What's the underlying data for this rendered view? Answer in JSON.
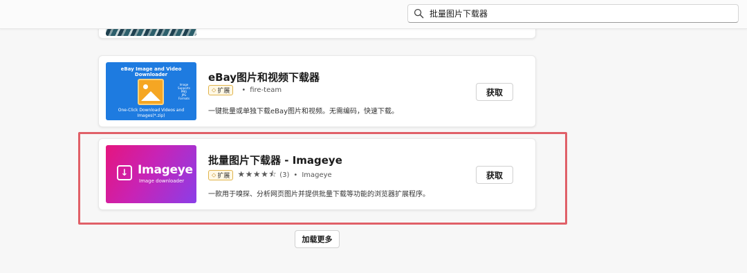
{
  "search": {
    "value": "批量图片下载器",
    "icon": "search-icon"
  },
  "results": [
    {
      "id": "ebay",
      "title": "eBay图片和视频下载器",
      "badge": "扩展",
      "publisher": "fire-team",
      "description": "一键批量或单独下载eBay图片和视频。无需编码，快速下载。",
      "get_label": "获取",
      "thumb": {
        "headline": "eBay Image and Video Downloader",
        "side_lines": [
          "Image",
          "Supports",
          "PNG",
          "JPG",
          "Formats"
        ],
        "bottom": "One-Click Download Videos and Images(*.zip)"
      },
      "accent": "#1e7be0"
    },
    {
      "id": "imageeye",
      "title": "批量图片下载器",
      "title_separator": " - ",
      "title_dev": "Imageye",
      "badge": "扩展",
      "rating": 4.5,
      "stars": "★★★★⯪",
      "rating_count": "(3)",
      "publisher": "Imageye",
      "description": "一款用于嗅探、分析网页图片并提供批量下载等功能的浏览器扩展程序。",
      "get_label": "获取",
      "thumb": {
        "logo": "Imageye",
        "tagline": "Image downloader"
      },
      "accent": "#c823b5"
    }
  ],
  "load_more_label": "加载更多",
  "highlight_color": "#e06068"
}
